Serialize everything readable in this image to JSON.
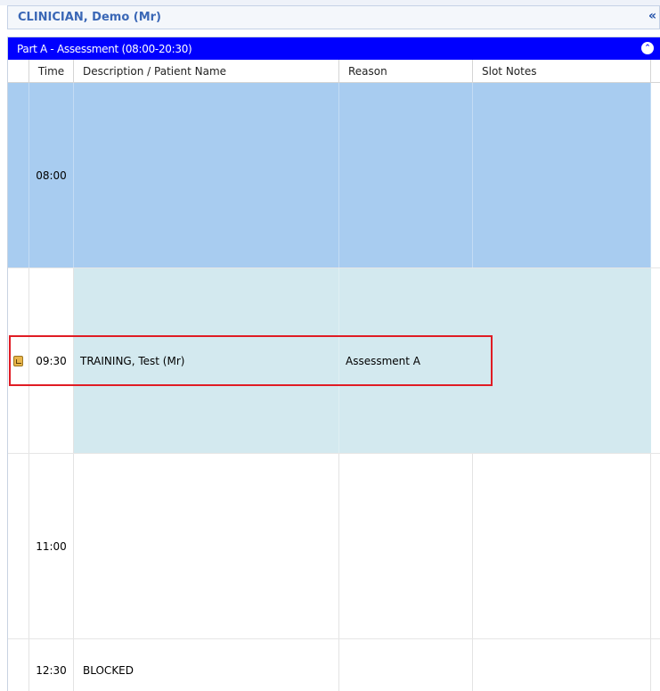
{
  "clinician": {
    "name": "CLINICIAN, Demo (Mr)",
    "collapse_icon": "double-chevron-left-icon"
  },
  "panel": {
    "title": "Part A - Assessment (08:00-20:30)",
    "toggle_icon": "circle-chevron-up-icon",
    "header_color": "#0000ff"
  },
  "columns": {
    "time": "Time",
    "description": "Description / Patient Name",
    "reason": "Reason",
    "slot_notes": "Slot Notes"
  },
  "rows": [
    {
      "time": "08:00",
      "description": "",
      "reason": "",
      "slot_notes": "",
      "status": "blue"
    },
    {
      "time": "09:30",
      "description": "TRAINING, Test (Mr)",
      "reason": "Assessment A",
      "slot_notes": "",
      "status": "booked",
      "icon": "appointment-icon"
    },
    {
      "time": "11:00",
      "description": "",
      "reason": "",
      "slot_notes": "",
      "status": "free"
    },
    {
      "time": "12:30",
      "description": "BLOCKED",
      "reason": "",
      "slot_notes": "",
      "status": "blocked"
    }
  ],
  "colors": {
    "slot_blue": "#a8ccf0",
    "slot_teal": "#d3e9ef",
    "highlight": "#e01c24",
    "clinician_text": "#3a67b6"
  }
}
